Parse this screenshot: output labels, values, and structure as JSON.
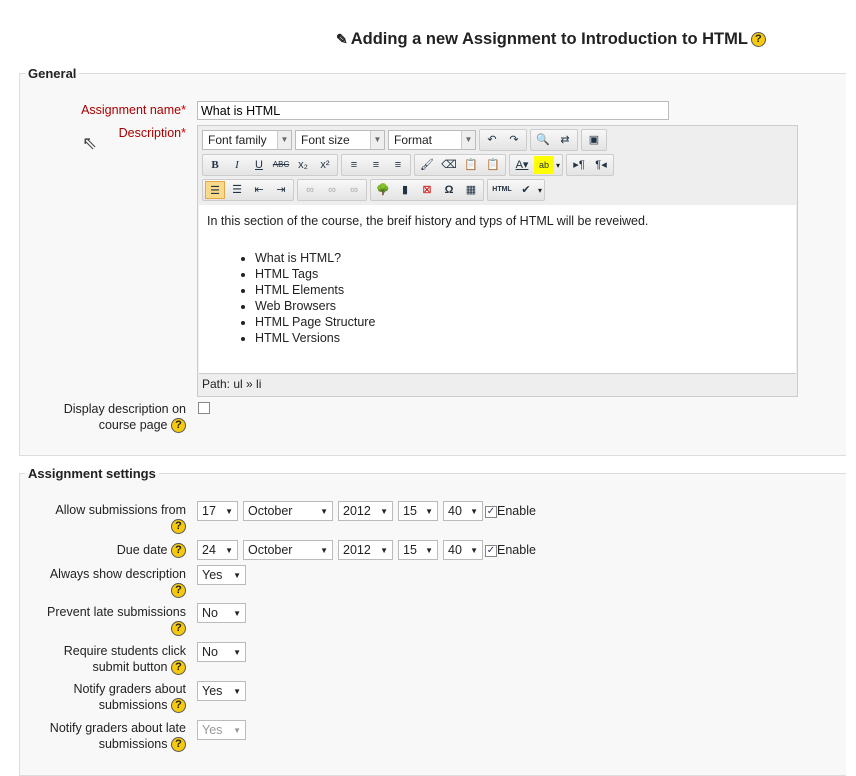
{
  "page": {
    "title": "Adding a new Assignment to Introduction to HTML"
  },
  "general": {
    "legend": "General",
    "name_label": "Assignment name",
    "name_value": "What is HTML",
    "desc_label": "Description",
    "required": "*",
    "editor": {
      "font_family": "Font family",
      "font_size": "Font size",
      "format": "Format",
      "text": "In this section of the course, the breif history and typs of HTML will be reveiwed.",
      "items": [
        "What is HTML?",
        "HTML Tags",
        "HTML Elements",
        "Web Browsers",
        "HTML Page Structure",
        "HTML Versions"
      ],
      "path": "Path: ul » li"
    },
    "display_label": "Display description on course page"
  },
  "settings": {
    "legend": "Assignment settings",
    "allow_label": "Allow submissions from",
    "allow": {
      "day": "17",
      "month": "October",
      "year": "2012",
      "hour": "15",
      "minute": "40",
      "enable": "Enable"
    },
    "due_label": "Due date",
    "due": {
      "day": "24",
      "month": "October",
      "year": "2012",
      "hour": "15",
      "minute": "40",
      "enable": "Enable"
    },
    "always_label": "Always show description",
    "always_value": "Yes",
    "prevent_label": "Prevent late submissions",
    "prevent_value": "No",
    "require_label": "Require students click submit button",
    "require_value": "No",
    "notify_label": "Notify graders about submissions",
    "notify_value": "Yes",
    "notify_late_label": "Notify graders about late submissions",
    "notify_late_value": "Yes"
  },
  "help": "?"
}
